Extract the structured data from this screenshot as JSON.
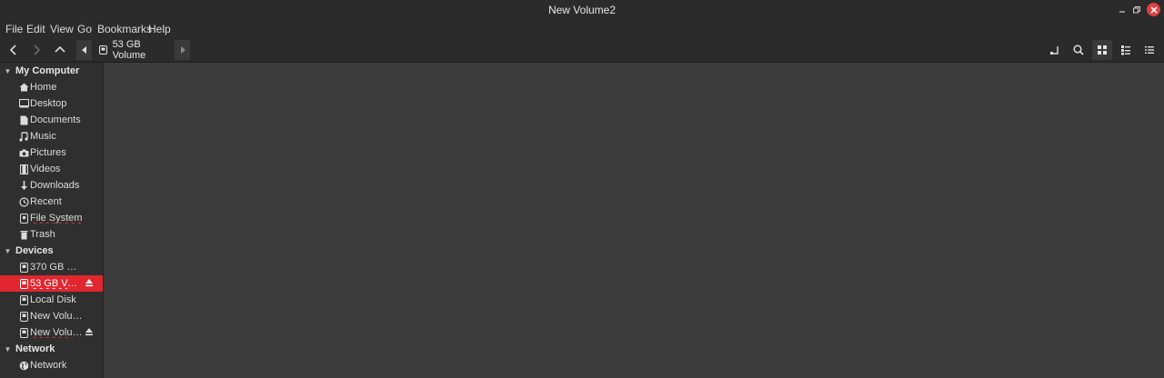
{
  "window": {
    "title": "New Volume2"
  },
  "menubar": [
    "File",
    "Edit",
    "View",
    "Go",
    "Bookmarks",
    "Help"
  ],
  "toolbar": {
    "location": "53 GB Volume",
    "icons": [
      "back-icon",
      "forward-icon",
      "up-icon",
      "terminal-icon",
      "search-icon",
      "grid-view-icon",
      "list-view-icon",
      "compact-view-icon"
    ]
  },
  "sidebar": {
    "sections": [
      {
        "title": "My Computer",
        "items": [
          "Home",
          "Desktop",
          "Documents",
          "Music",
          "Pictures",
          "Videos",
          "Downloads",
          "Recent",
          "File System",
          "Trash"
        ]
      },
      {
        "title": "Devices",
        "items": [
          "370 GB Vol...",
          "53 GB Volu...",
          "Local Disk",
          "New Volume",
          "New Volume"
        ]
      },
      {
        "title": "Network",
        "items": [
          "Network"
        ]
      }
    ],
    "selected": "53 GB Volu..."
  },
  "colors": {
    "accent": "#e0262e",
    "background": "#2b2b2b",
    "content": "#3c3c3c"
  }
}
